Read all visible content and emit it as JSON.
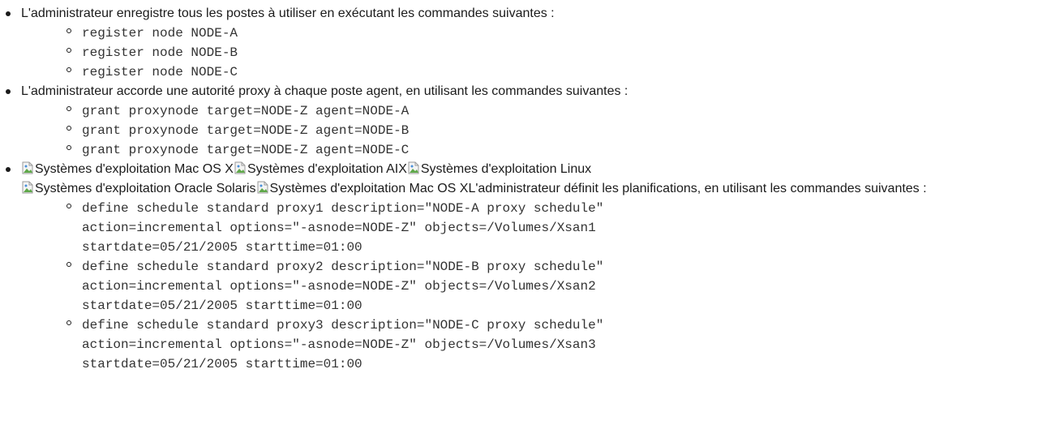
{
  "items": [
    {
      "text": "L'administrateur enregistre tous les postes à utiliser en exécutant les commandes suivantes :",
      "commands": [
        "register node NODE-A",
        "register node NODE-B",
        "register node NODE-C"
      ]
    },
    {
      "text": "L'administrateur accorde une autorité proxy à chaque poste agent, en utilisant les commandes suivantes :",
      "commands": [
        "grant proxynode target=NODE-Z agent=NODE-A",
        "grant proxynode target=NODE-Z agent=NODE-B",
        "grant proxynode target=NODE-Z agent=NODE-C"
      ]
    },
    {
      "os_images": [
        {
          "alt": "Systèmes d'exploitation Mac OS X",
          "icon": "broken-image-icon"
        },
        {
          "alt": "Systèmes d'exploitation AIX",
          "icon": "broken-image-icon"
        },
        {
          "alt": "Systèmes d'exploitation Linux",
          "icon": "broken-image-icon"
        },
        {
          "alt": "Systèmes d'exploitation Oracle Solaris",
          "icon": "broken-image-icon"
        },
        {
          "alt": "Systèmes d'exploitation Mac OS X",
          "icon": "broken-image-icon"
        }
      ],
      "text": "L'administrateur définit les planifications, en utilisant les commandes suivantes :",
      "commands": [
        "define schedule standard proxy1 description=\"NODE-A proxy schedule\" action=incremental options=\"-asnode=NODE-Z\" objects=/Volumes/Xsan1 startdate=05/21/2005 starttime=01:00",
        "define schedule standard proxy2 description=\"NODE-B proxy schedule\" action=incremental options=\"-asnode=NODE-Z\" objects=/Volumes/Xsan2 startdate=05/21/2005 starttime=01:00",
        "define schedule standard proxy3 description=\"NODE-C proxy schedule\" action=incremental options=\"-asnode=NODE-Z\" objects=/Volumes/Xsan3 startdate=05/21/2005 starttime=01:00"
      ]
    }
  ]
}
